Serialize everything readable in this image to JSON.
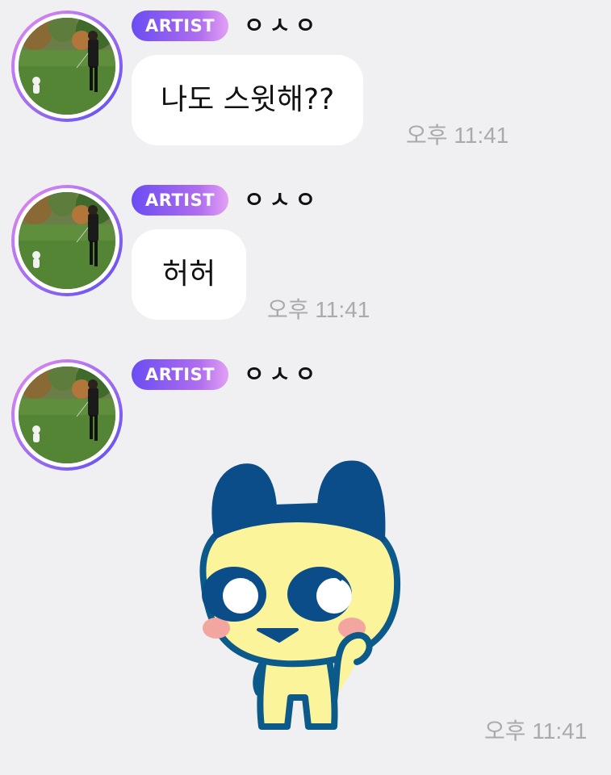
{
  "messages": [
    {
      "badge": "ARTIST",
      "sender": "ㅇㅅㅇ",
      "text": "나도 스윗해??",
      "time": "오후 11:41"
    },
    {
      "badge": "ARTIST",
      "sender": "ㅇㅅㅇ",
      "text": "허허",
      "time": "오후 11:41"
    },
    {
      "badge": "ARTIST",
      "sender": "ㅇㅅㅇ",
      "sticker": "mametchi-character-sticker",
      "time": "오후 11:41"
    }
  ],
  "colors": {
    "background": "#f0f0f2",
    "bubble": "#ffffff",
    "badge_gradient_start": "#6a4df2",
    "badge_gradient_end": "#e3a0f4",
    "timestamp": "#a9a9ae"
  }
}
